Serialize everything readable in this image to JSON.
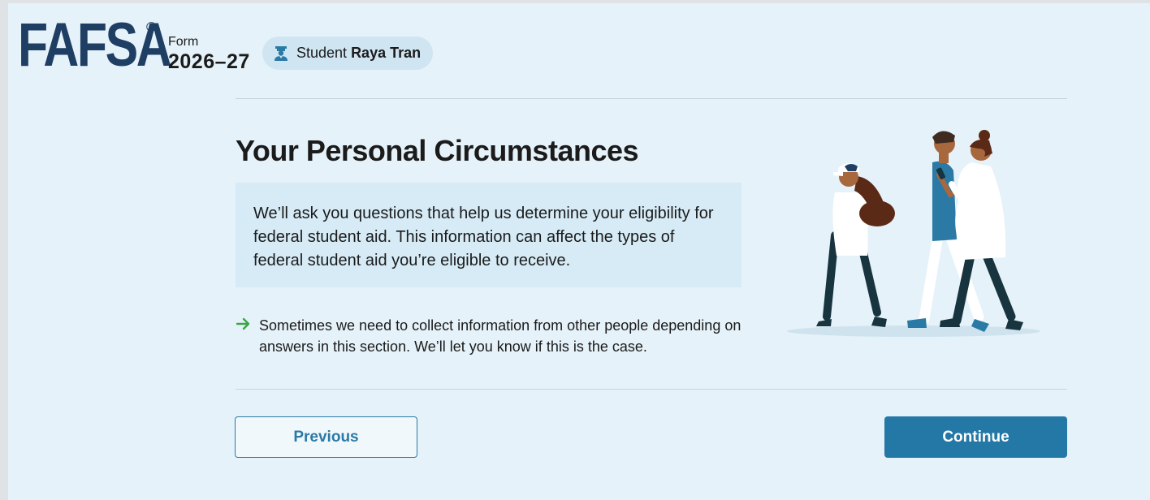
{
  "header": {
    "logo_text": "FAFSA",
    "logo_reg": "®",
    "form_label": "Form",
    "form_year": "2026–27",
    "student_label": "Student",
    "student_name": "Raya Tran",
    "student_icon": "graduate-icon"
  },
  "main": {
    "title": "Your Personal Circumstances",
    "info_text": "We’ll ask you questions that help us determine your eligibility for federal student aid. This information can affect the types of federal student aid you’re eligible to receive.",
    "note_icon": "arrow-right-icon",
    "note_text": "Sometimes we need to collect information from other people depending on answers in this section. We’ll let you know if this is the case.",
    "illustration": "people-walking-illustration"
  },
  "buttons": {
    "previous": "Previous",
    "continue": "Continue"
  },
  "colors": {
    "brand": "#1e3e63",
    "primary": "#2478a6",
    "accent_arrow": "#3aa648",
    "background": "#e6f2f9"
  }
}
